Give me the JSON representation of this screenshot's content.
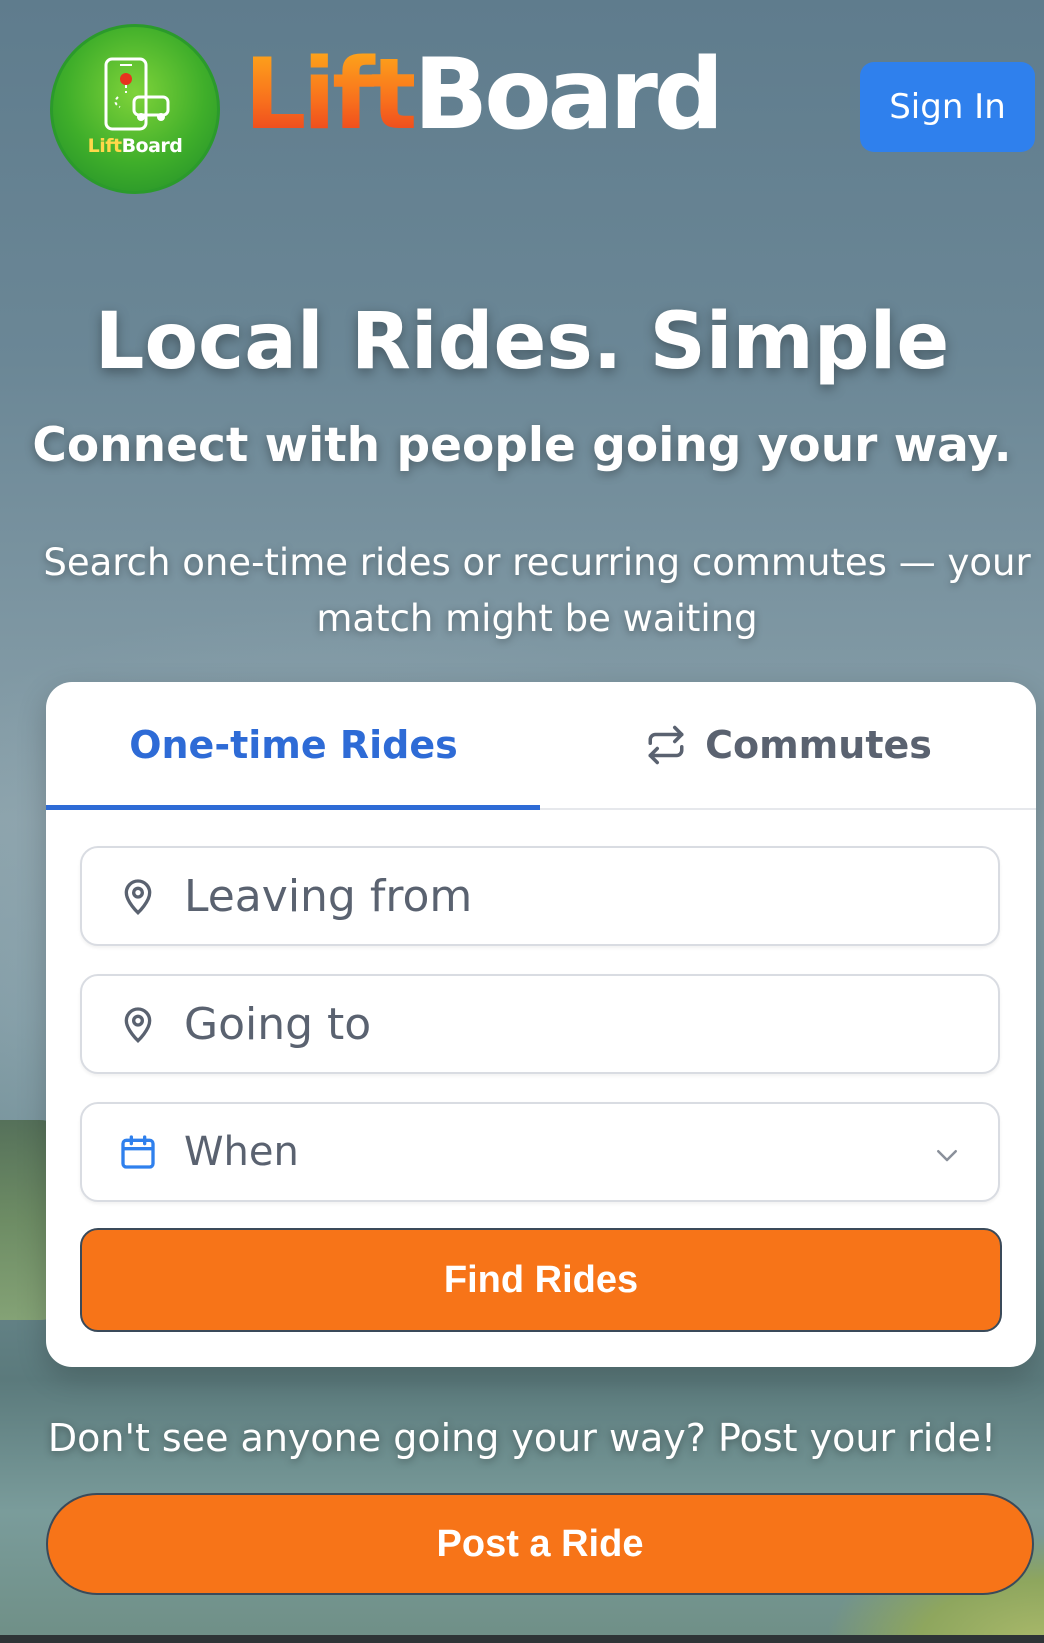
{
  "header": {
    "brand_part1": "Lift",
    "brand_part2": "Board",
    "logo_text_part1": "Lift",
    "logo_text_part2": "Board",
    "signin_label": "Sign In"
  },
  "hero": {
    "title": "Local Rides. Simple",
    "subtitle": "Connect with people going your way.",
    "description": "Search one-time rides or recurring commutes — your match might be waiting"
  },
  "search_card": {
    "tabs": [
      {
        "label": "One-time Rides",
        "active": true
      },
      {
        "label": "Commutes",
        "active": false,
        "icon": "repeat-icon"
      }
    ],
    "leaving_from_placeholder": "Leaving from",
    "going_to_placeholder": "Going to",
    "when_label": "When",
    "find_button_label": "Find Rides"
  },
  "post": {
    "note": "Don't see anyone going your way? Post your ride!",
    "button_label": "Post a Ride"
  },
  "colors": {
    "accent_blue": "#2f80ed",
    "tab_active": "#2e6bd6",
    "cta_orange": "#f77418",
    "logo_green": "#3fae2a"
  }
}
